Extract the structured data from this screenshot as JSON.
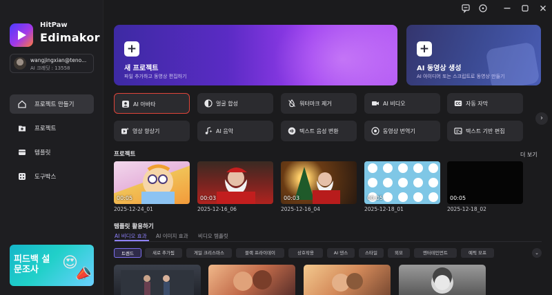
{
  "app": {
    "brand_top": "HitPaw",
    "brand_name": "Edimakor"
  },
  "account": {
    "email": "wangjingxian@teno...",
    "credit": "AI 크레딧 : 13558"
  },
  "window_controls": [
    "feedback-icon",
    "info-icon",
    "minimize-icon",
    "maximize-icon",
    "close-icon"
  ],
  "sidebar": {
    "items": [
      {
        "label": "프로젝트 만들기",
        "icon": "home-icon",
        "active": true
      },
      {
        "label": "프로젝트",
        "icon": "folder-icon",
        "active": false
      },
      {
        "label": "템플릿",
        "icon": "template-icon",
        "active": false
      },
      {
        "label": "도구박스",
        "icon": "toolbox-icon",
        "active": false
      }
    ],
    "promo": {
      "text": "피드백 설문조사"
    }
  },
  "hero": {
    "new_project": {
      "title": "새 프로젝트",
      "subtitle": "파일 추가하고 동영상 편집하기"
    },
    "ai_video": {
      "title": "AI 동영상 생성",
      "subtitle": "AI 아이디어 또는 스크립트로 동영상 만들기"
    }
  },
  "tools": [
    {
      "label": "AI 아바타",
      "icon": "avatar-icon",
      "selected": true
    },
    {
      "label": "얼굴 합성",
      "icon": "face-swap-icon"
    },
    {
      "label": "워터마크 제거",
      "icon": "watermark-remove-icon"
    },
    {
      "label": "AI 비디오",
      "icon": "ai-video-icon"
    },
    {
      "label": "자동 자막",
      "icon": "cc-icon"
    },
    {
      "label": "영상 향상기",
      "icon": "enhance-icon"
    },
    {
      "label": "AI 음악",
      "icon": "music-icon"
    },
    {
      "label": "텍스트 음성 변환",
      "icon": "tts-icon"
    },
    {
      "label": "동영상 번역기",
      "icon": "translate-icon"
    },
    {
      "label": "텍스트 기반 편집",
      "icon": "text-edit-icon"
    }
  ],
  "projects": {
    "title": "프로젝트",
    "more": "더 보기",
    "items": [
      {
        "name": "2025-12-24_01",
        "duration": "00:05"
      },
      {
        "name": "2025-12-16_06",
        "duration": "00:03"
      },
      {
        "name": "2025-12-16_04",
        "duration": "00:03"
      },
      {
        "name": "2025-12-18_01",
        "duration": "00:05"
      },
      {
        "name": "2025-12-18_02",
        "duration": "00:05"
      }
    ]
  },
  "templates": {
    "title": "템플릿 활용하기",
    "tabs": [
      "AI 비디오 효과",
      "AI 이미지 효과",
      "비디오 템플릿"
    ],
    "chips": [
      "트렌드",
      "새로 추가됨",
      "게일 크리스마스",
      "블랙 프라이데이",
      "상호작용",
      "AI 댄스",
      "스타일",
      "외모",
      "엔터테인먼트",
      "예픽 모프"
    ]
  }
}
